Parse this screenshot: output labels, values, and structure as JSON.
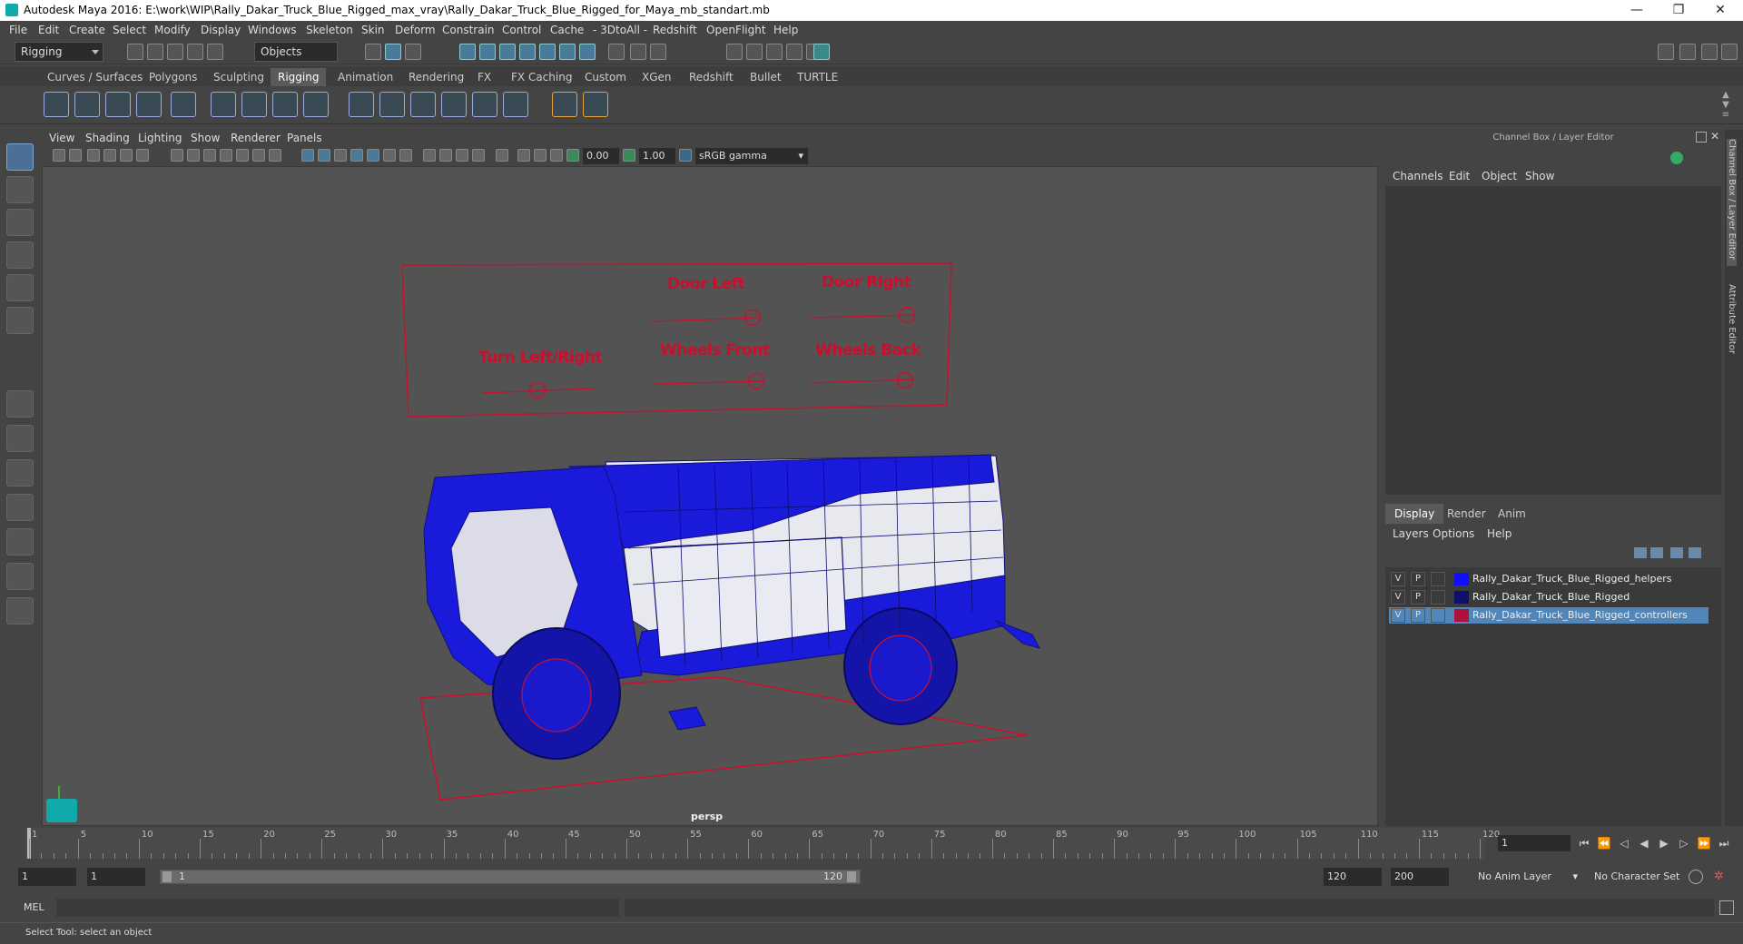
{
  "titlebar": {
    "title": "Autodesk Maya 2016: E:\\work\\WIP\\Rally_Dakar_Truck_Blue_Rigged_max_vray\\Rally_Dakar_Truck_Blue_Rigged_for_Maya_mb_standart.mb",
    "minimize": "—",
    "maximize": "❐",
    "close": "✕"
  },
  "menubar": [
    "File",
    "Edit",
    "Create",
    "Select",
    "Modify",
    "Display",
    "Windows",
    "Skeleton",
    "Skin",
    "Deform",
    "Constrain",
    "Control",
    "Cache",
    "- 3DtoAll -",
    "Redshift",
    "OpenFlight",
    "Help"
  ],
  "statusline": {
    "mode_menu": "Rigging",
    "selection_mode": "Objects"
  },
  "shelf_tabs": [
    "Curves / Surfaces",
    "Polygons",
    "Sculpting",
    "Rigging",
    "Animation",
    "Rendering",
    "FX",
    "FX Caching",
    "Custom",
    "XGen",
    "Redshift",
    "Bullet",
    "TURTLE"
  ],
  "shelf_active_tab": "Rigging",
  "viewport": {
    "menu": [
      "View",
      "Shading",
      "Lighting",
      "Show",
      "Renderer",
      "Panels"
    ],
    "exposure": "0.00",
    "gamma": "1.00",
    "color_space": "sRGB gamma",
    "camera_label": "persp",
    "control_panel_labels": {
      "door_left": "Door Left",
      "door_right": "Door Right",
      "turn": "Turn  Left/Right",
      "wheels_front": "Wheels Front",
      "wheels_back": "Wheels Back"
    },
    "colors": {
      "controller": "#c8102e",
      "truck_blue": "#1a1adb",
      "truck_white": "#e8e8ef"
    }
  },
  "channel_box": {
    "title": "Channel Box / Layer Editor",
    "menu": [
      "Channels",
      "Edit",
      "Object",
      "Show"
    ]
  },
  "layer_editor": {
    "tabs": [
      "Display",
      "Render",
      "Anim"
    ],
    "active_tab": "Display",
    "menu": [
      "Layers",
      "Options",
      "Help"
    ],
    "layers": [
      {
        "v": "V",
        "p": "P",
        "name": "Rally_Dakar_Truck_Blue_Rigged_helpers",
        "color": "#1010ff",
        "selected": false
      },
      {
        "v": "V",
        "p": "P",
        "name": "Rally_Dakar_Truck_Blue_Rigged",
        "color": "#10106a",
        "selected": false
      },
      {
        "v": "V",
        "p": "P",
        "name": "Rally_Dakar_Truck_Blue_Rigged_controllers",
        "color": "#b0103a",
        "selected": true
      }
    ]
  },
  "side_tabs": {
    "channel_box": "Channel Box / Layer Editor",
    "attribute_editor": "Attribute Editor"
  },
  "timeline": {
    "ticks": [
      "1",
      "5",
      "10",
      "15",
      "20",
      "25",
      "30",
      "35",
      "40",
      "45",
      "50",
      "55",
      "60",
      "65",
      "70",
      "75",
      "80",
      "85",
      "90",
      "95",
      "100",
      "105",
      "110",
      "115",
      "120"
    ],
    "current_frame": "1"
  },
  "range": {
    "start": "1",
    "playback_start": "1",
    "slider_start": "1",
    "slider_end": "120",
    "playback_end": "120",
    "end": "200",
    "anim_layer": "No Anim Layer",
    "character_set": "No Character Set"
  },
  "mel": {
    "label": "MEL"
  },
  "help_line": "Select Tool: select an object"
}
